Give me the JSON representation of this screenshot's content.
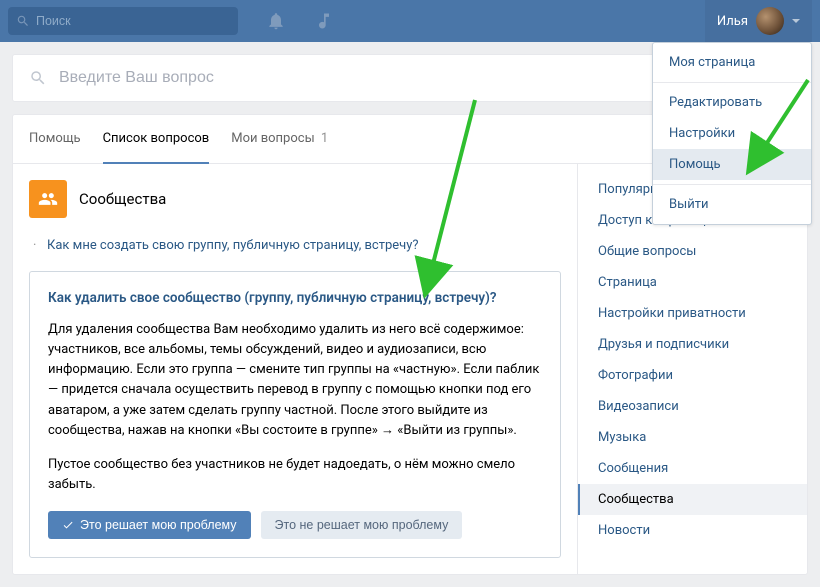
{
  "topbar": {
    "search_placeholder": "Поиск",
    "user_name": "Илья"
  },
  "question_bar": {
    "placeholder": "Введите Ваш вопрос"
  },
  "tabs": {
    "help": "Помощь",
    "list": "Список вопросов",
    "my": "Мои вопросы",
    "my_count": "1"
  },
  "section": {
    "title": "Сообщества",
    "link1": "Как мне создать свою группу, публичную страницу, встречу?"
  },
  "qa": {
    "title": "Как удалить свое сообщество (группу, публичную страницу, встречу)?",
    "body1": "Для удаления сообщества Вам необходимо удалить из него всё содержимое: участников, все альбомы, темы обсуждений, видео и аудиозаписи, всю информацию. Если это группа — смените тип группы на «частную». Если паблик — придется сначала осуществить перевод в группу с помощью кнопки под его аватаром, а уже затем сделать группу частной. После этого выйдите из сообщества, нажав на кнопки «Вы состоите в группе» → «Выйти из группы».",
    "body2": "Пустое сообщество без участников не будет надоедать, о нём можно смело забыть.",
    "btn_yes": "Это решает мою проблему",
    "btn_no": "Это не решает мою проблему"
  },
  "side": {
    "items": [
      "Популярные",
      "Доступ к странице",
      "Общие вопросы",
      "Страница",
      "Настройки приватности",
      "Друзья и подписчики",
      "Фотографии",
      "Видеозаписи",
      "Музыка",
      "Сообщения",
      "Сообщества",
      "Новости"
    ]
  },
  "dropdown": {
    "my_page": "Моя страница",
    "edit": "Редактировать",
    "settings": "Настройки",
    "help": "Помощь",
    "logout": "Выйти"
  }
}
